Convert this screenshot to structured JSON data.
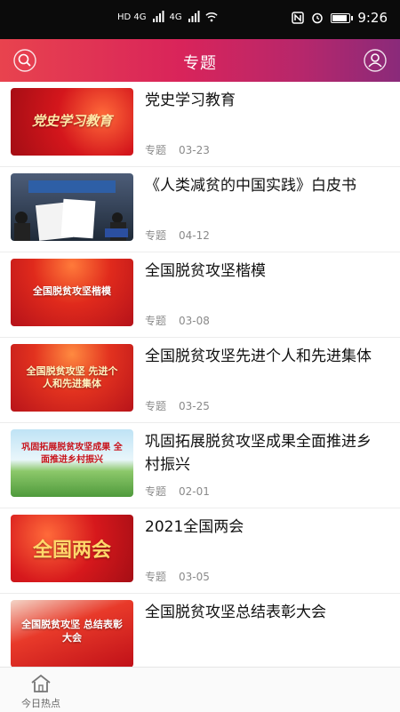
{
  "status_bar": {
    "time": "9:26",
    "network_left": "HD 4G",
    "network_right": "4G",
    "icons": [
      "hd-icon",
      "signal-icon",
      "wifi-icon",
      "nfc-icon",
      "alarm-icon",
      "battery-icon"
    ],
    "battery_level": 0.8
  },
  "header": {
    "title": "专题",
    "left_icon": "search-icon",
    "right_icon": "user-icon"
  },
  "articles": [
    {
      "title": "党史学习教育",
      "category": "专题",
      "date": "03-23",
      "thumb_caption": "党史学习教育"
    },
    {
      "title": "《人类减贫的中国实践》白皮书",
      "category": "专题",
      "date": "04-12",
      "thumb_caption": ""
    },
    {
      "title": "全国脱贫攻坚楷模",
      "category": "专题",
      "date": "03-08",
      "thumb_caption": "全国脱贫攻坚楷模"
    },
    {
      "title": "全国脱贫攻坚先进个人和先进集体",
      "category": "专题",
      "date": "03-25",
      "thumb_caption": "全国脱贫攻坚 先进个人和先进集体"
    },
    {
      "title": "巩固拓展脱贫攻坚成果全面推进乡村振兴",
      "category": "专题",
      "date": "02-01",
      "thumb_caption": "巩固拓展脱贫攻坚成果 全面推进乡村振兴"
    },
    {
      "title": "2021全国两会",
      "category": "专题",
      "date": "03-05",
      "thumb_caption": "全国两会"
    },
    {
      "title": "全国脱贫攻坚总结表彰大会",
      "category": "",
      "date": "",
      "thumb_caption": "全国脱贫攻坚 总结表彰大会"
    }
  ],
  "tabbar": {
    "home_label": "今日热点",
    "home_icon": "home-icon"
  },
  "colors": {
    "header_start": "#e8434e",
    "header_end": "#8a2a7a",
    "thumb_red": "#c8141c"
  }
}
